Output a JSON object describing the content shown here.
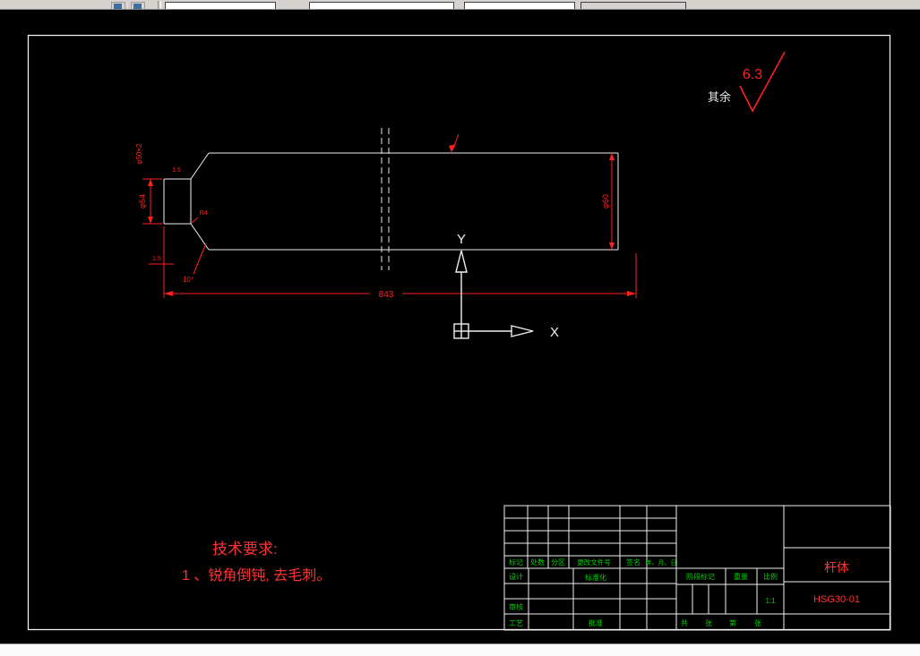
{
  "annotations": {
    "roughness_value": "6.3",
    "roughness_rest": "其余",
    "tech_title": "技术要求:",
    "tech_item": "1 、锐角倒钝, 去毛刺。"
  },
  "ucs": {
    "x": "X",
    "y": "Y"
  },
  "dims": {
    "length": "843",
    "dia_main": "φ60",
    "dia_small": "φ54",
    "groove": "φ50×2",
    "chamfer_top": "1.5",
    "chamfer_end": "1.5",
    "taper": "10°",
    "fillet": "R4"
  },
  "titleblock": {
    "h_mark": "标记",
    "h_count": "处数",
    "h_zone": "分区",
    "h_doc": "更改文件号",
    "h_sign": "签名",
    "h_date": "年、月、日",
    "design": "设计",
    "standardize": "标准化",
    "check": "审核",
    "process": "工艺",
    "approve": "批准",
    "stage": "阶段标记",
    "weight": "重量",
    "scale": "比例",
    "scale_value": "1:1",
    "total": "共",
    "sheet": "张",
    "no": "第",
    "sheet2": "张",
    "part": "杆体",
    "code": "HSG30-01"
  },
  "colors": {
    "dimension_red": "#ff2020",
    "label_green": "#00d000",
    "line_white": "#f0f0f0",
    "canvas_black": "#000000"
  }
}
